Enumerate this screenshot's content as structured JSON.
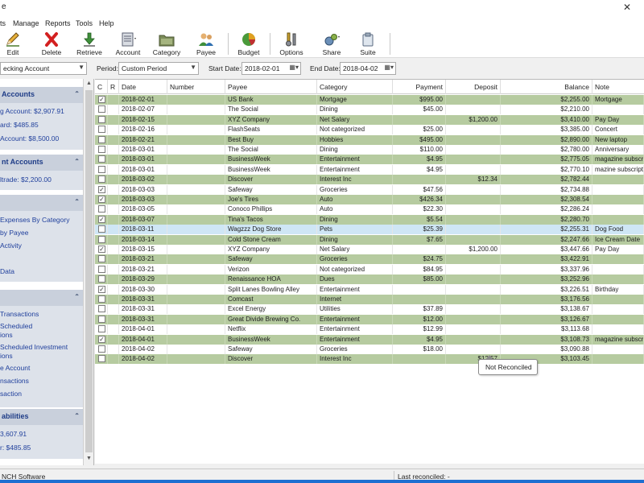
{
  "window": {
    "title_fragment": "e",
    "close_glyph": "✕"
  },
  "menu": [
    "ts",
    "Manage",
    "Reports",
    "Tools",
    "Help"
  ],
  "toolbar": [
    {
      "label": "Edit",
      "icon": "pencil-icon"
    },
    {
      "label": "Delete",
      "icon": "red-x-icon"
    },
    {
      "label": "Retrieve",
      "icon": "down-arrow-icon"
    },
    {
      "label": "Account",
      "icon": "ledger-icon"
    },
    {
      "label": "Category",
      "icon": "folder-icon"
    },
    {
      "label": "Payee",
      "icon": "people-icon"
    },
    {
      "label": "Budget",
      "icon": "pie-chart-icon"
    },
    {
      "label": "Options",
      "icon": "tools-icon"
    },
    {
      "label": "Share",
      "icon": "share-icon"
    },
    {
      "label": "Suite",
      "icon": "suite-icon"
    }
  ],
  "filters": {
    "account_value": "ecking Account",
    "period_label": "Period:",
    "period_value": "Custom Period",
    "start_label": "Start Date:",
    "start_value": "2018-02-01",
    "end_label": "End Date:",
    "end_value": "2018-04-02"
  },
  "sidebar": {
    "panels": [
      {
        "title": "Accounts",
        "items": [
          "g Account: $2,907.91",
          "ard: $485.85",
          "Account: $8,500.00"
        ]
      },
      {
        "title": "nt Accounts",
        "items": [
          "ltrade: $2,200.00"
        ]
      },
      {
        "title": "",
        "items": [
          "Expenses By Category",
          "by Payee",
          "Activity",
          "",
          "Data"
        ]
      },
      {
        "title": "",
        "items": [
          "Transactions",
          "Scheduled",
          "ions",
          "Scheduled Investment",
          "ions",
          "e Account",
          "nsactions",
          "saction"
        ]
      },
      {
        "title": "abilities",
        "items": [
          "3,607.91",
          "r: $485.85"
        ]
      }
    ]
  },
  "columns": {
    "c": "C",
    "r": "R",
    "date": "Date",
    "number": "Number",
    "payee": "Payee",
    "category": "Category",
    "payment": "Payment",
    "deposit": "Deposit",
    "balance": "Balance",
    "note": "Note"
  },
  "transactions": [
    {
      "checked": true,
      "date": "2018-02-01",
      "number": "",
      "payee": "US Bank",
      "category": "Mortgage",
      "payment": "$995.00",
      "deposit": "",
      "balance": "$2,255.00",
      "note": "Mortgage",
      "style": "g"
    },
    {
      "checked": false,
      "date": "2018-02-07",
      "number": "",
      "payee": "The Social",
      "category": "Dining",
      "payment": "$45.00",
      "deposit": "",
      "balance": "$2,210.00",
      "note": "",
      "style": "w"
    },
    {
      "checked": false,
      "date": "2018-02-15",
      "number": "",
      "payee": "XYZ Company",
      "category": "Net Salary",
      "payment": "",
      "deposit": "$1,200.00",
      "balance": "$3,410.00",
      "note": "Pay Day",
      "style": "g"
    },
    {
      "checked": false,
      "date": "2018-02-16",
      "number": "",
      "payee": "FlashSeats",
      "category": "Not categorized",
      "payment": "$25.00",
      "deposit": "",
      "balance": "$3,385.00",
      "note": "Concert",
      "style": "w"
    },
    {
      "checked": false,
      "date": "2018-02-21",
      "number": "",
      "payee": "Best Buy",
      "category": "Hobbies",
      "payment": "$495.00",
      "deposit": "",
      "balance": "$2,890.00",
      "note": "New laptop",
      "style": "g"
    },
    {
      "checked": false,
      "date": "2018-03-01",
      "number": "",
      "payee": "The Social",
      "category": "Dining",
      "payment": "$110.00",
      "deposit": "",
      "balance": "$2,780.00",
      "note": "Anniversary",
      "style": "w"
    },
    {
      "checked": false,
      "date": "2018-03-01",
      "number": "",
      "payee": "BusinessWeek",
      "category": "Entertainment",
      "payment": "$4.95",
      "deposit": "",
      "balance": "$2,775.05",
      "note": "magazine subscrip",
      "style": "g"
    },
    {
      "checked": false,
      "date": "2018-03-01",
      "number": "",
      "payee": "BusinessWeek",
      "category": "Entertainment",
      "payment": "$4.95",
      "deposit": "",
      "balance": "$2,770.10",
      "note": "mazine subscript",
      "style": "w"
    },
    {
      "checked": false,
      "date": "2018-03-02",
      "number": "",
      "payee": "Discover",
      "category": "Interest Inc",
      "payment": "",
      "deposit": "$12.34",
      "balance": "$2,782.44",
      "note": "",
      "style": "g"
    },
    {
      "checked": true,
      "date": "2018-03-03",
      "number": "",
      "payee": "Safeway",
      "category": "Groceries",
      "payment": "$47.56",
      "deposit": "",
      "balance": "$2,734.88",
      "note": "",
      "style": "w"
    },
    {
      "checked": true,
      "date": "2018-03-03",
      "number": "",
      "payee": "Joe's Tires",
      "category": "Auto",
      "payment": "$426.34",
      "deposit": "",
      "balance": "$2,308.54",
      "note": "",
      "style": "g"
    },
    {
      "checked": false,
      "date": "2018-03-05",
      "number": "",
      "payee": "Conoco Phillips",
      "category": "Auto",
      "payment": "$22.30",
      "deposit": "",
      "balance": "$2,286.24",
      "note": "",
      "style": "w"
    },
    {
      "checked": true,
      "date": "2018-03-07",
      "number": "",
      "payee": "Tina's Tacos",
      "category": "Dining",
      "payment": "$5.54",
      "deposit": "",
      "balance": "$2,280.70",
      "note": "",
      "style": "g"
    },
    {
      "checked": false,
      "date": "2018-03-11",
      "number": "",
      "payee": "Wagzzz Dog Store",
      "category": "Pets",
      "payment": "$25.39",
      "deposit": "",
      "balance": "$2,255.31",
      "note": "Dog Food",
      "style": "sel"
    },
    {
      "checked": false,
      "date": "2018-03-14",
      "number": "",
      "payee": "Cold Stone Cream",
      "category": "Dining",
      "payment": "$7.65",
      "deposit": "",
      "balance": "$2,247.66",
      "note": "Ice Cream Date",
      "style": "g"
    },
    {
      "checked": true,
      "date": "2018-03-15",
      "number": "",
      "payee": "XYZ Company",
      "category": "Net Salary",
      "payment": "",
      "deposit": "$1,200.00",
      "balance": "$3,447.66",
      "note": "Pay Day",
      "style": "w"
    },
    {
      "checked": false,
      "date": "2018-03-21",
      "number": "",
      "payee": "Safeway",
      "category": "Groceries",
      "payment": "$24.75",
      "deposit": "",
      "balance": "$3,422.91",
      "note": "",
      "style": "g"
    },
    {
      "checked": false,
      "date": "2018-03-21",
      "number": "",
      "payee": "Verizon",
      "category": "Not categorized",
      "payment": "$84.95",
      "deposit": "",
      "balance": "$3,337.96",
      "note": "",
      "style": "w"
    },
    {
      "checked": false,
      "date": "2018-03-29",
      "number": "",
      "payee": "Renaissance HOA",
      "category": "Dues",
      "payment": "$85.00",
      "deposit": "",
      "balance": "$3,252.96",
      "note": "",
      "style": "g"
    },
    {
      "checked": true,
      "date": "2018-03-30",
      "number": "",
      "payee": "Split Lanes Bowling Alley",
      "category": "Entertainment",
      "payment": "",
      "deposit": "",
      "balance": "$3,226.51",
      "note": "Birthday",
      "style": "w"
    },
    {
      "checked": false,
      "date": "2018-03-31",
      "number": "",
      "payee": "Comcast",
      "category": "Internet",
      "payment": "",
      "deposit": "",
      "balance": "$3,176.56",
      "note": "",
      "style": "g"
    },
    {
      "checked": false,
      "date": "2018-03-31",
      "number": "",
      "payee": "Excel Energy",
      "category": "Utilities",
      "payment": "$37.89",
      "deposit": "",
      "balance": "$3,138.67",
      "note": "",
      "style": "w"
    },
    {
      "checked": false,
      "date": "2018-03-31",
      "number": "",
      "payee": "Great Divide Brewing Co.",
      "category": "Entertainment",
      "payment": "$12.00",
      "deposit": "",
      "balance": "$3,126.67",
      "note": "",
      "style": "g"
    },
    {
      "checked": false,
      "date": "2018-04-01",
      "number": "",
      "payee": "Netflix",
      "category": "Entertainment",
      "payment": "$12.99",
      "deposit": "",
      "balance": "$3,113.68",
      "note": "",
      "style": "w"
    },
    {
      "checked": true,
      "date": "2018-04-01",
      "number": "",
      "payee": "BusinessWeek",
      "category": "Entertainment",
      "payment": "$4.95",
      "deposit": "",
      "balance": "$3,108.73",
      "note": "magazine subscrip",
      "style": "g"
    },
    {
      "checked": false,
      "date": "2018-04-02",
      "number": "",
      "payee": "Safeway",
      "category": "Groceries",
      "payment": "$18.00",
      "deposit": "",
      "balance": "$3,090.88",
      "note": "",
      "style": "w"
    },
    {
      "checked": false,
      "date": "2018-04-02",
      "number": "",
      "payee": "Discover",
      "category": "Interest Inc",
      "payment": "",
      "deposit": "$12.57",
      "balance": "$3,103.45",
      "note": "",
      "style": "g"
    }
  ],
  "tooltip": "Not Reconciled",
  "status": {
    "left": "NCH Software",
    "right": "Last reconciled: -"
  },
  "colors": {
    "row_green": "#b6cba0",
    "row_selected": "#cfe6f5",
    "sidebar_header": "#c9d0dc",
    "sidebar_link": "#1f3f9c"
  }
}
